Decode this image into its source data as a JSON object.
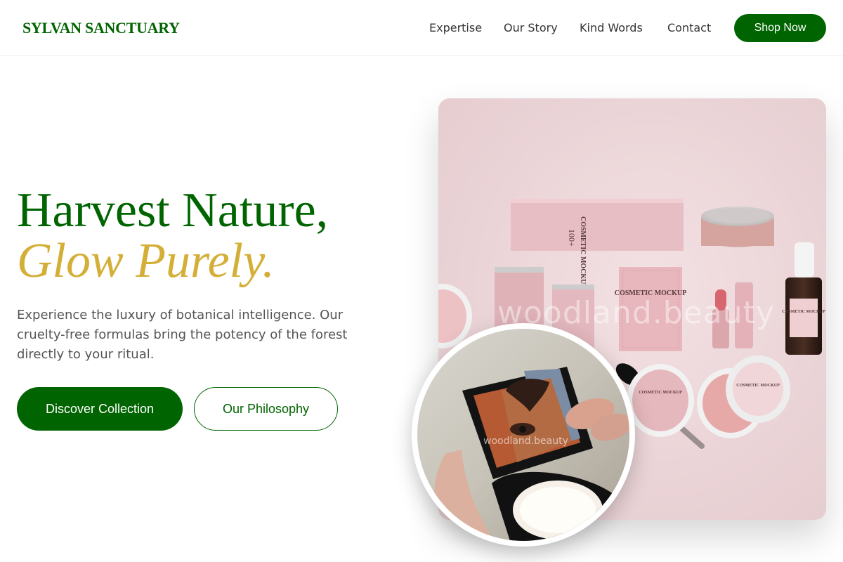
{
  "header": {
    "logo": "SYLVAN SANCTUARY",
    "nav": [
      "Expertise",
      "Our Story",
      "Kind Words",
      "Contact"
    ],
    "cta": "Shop Now"
  },
  "hero": {
    "headline_line1": "Harvest Nature,",
    "headline_line2": "Glow Purely.",
    "subtitle": "Experience the luxury of botanical intelligence. Our cruelty-free formulas bring the potency of the forest directly to your ritual.",
    "primary_button": "Discover Collection",
    "secondary_button": "Our Philosophy"
  },
  "images": {
    "product_watermark": "woodland.beauty",
    "mirror_watermark": "woodland.beauty",
    "product_labels": [
      "100+",
      "COSMETIC MOCKUP",
      "COSMETIC MOCKUP",
      "COSMETIC MOCKUP",
      "COSMETIC MOCKUP",
      "COSMETIC MOCKUP"
    ]
  },
  "colors": {
    "brand_green": "#006400",
    "accent_gold": "#d4af37",
    "product_pink": "#e9c4c8"
  }
}
